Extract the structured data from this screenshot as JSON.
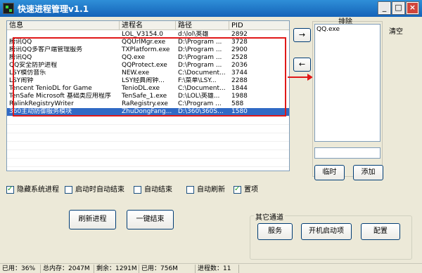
{
  "window": {
    "title": "快速进程管理v1.1",
    "icon": "terminal-icon",
    "controls": {
      "minimize": "_",
      "maximize": "□",
      "close": "×"
    }
  },
  "process_list": {
    "columns": [
      "信息",
      "进程名",
      "路径",
      "PID"
    ],
    "rows": [
      {
        "info": "",
        "name": "LOL_V3154.0",
        "path": "d:\\lol\\英雄",
        "pid": "2892"
      },
      {
        "info": "腾讯QQ",
        "name": "QQUrlMgr.exe",
        "path": "D:\\Program ...",
        "pid": "3728"
      },
      {
        "info": "腾讯QQ多客户端管理服务",
        "name": "TXPlatform.exe",
        "path": "D:\\Program ...",
        "pid": "2900"
      },
      {
        "info": "腾讯QQ",
        "name": "QQ.exe",
        "path": "D:\\Program ...",
        "pid": "2528"
      },
      {
        "info": "QQ安全防护进程",
        "name": "QQProtect.exe",
        "path": "D:\\Program ...",
        "pid": "2036"
      },
      {
        "info": "LSY模仿音乐",
        "name": "NEW.exe",
        "path": "C:\\Document...",
        "pid": "3744"
      },
      {
        "info": "LSY闹钟",
        "name": "LSY经典闹钟...",
        "path": "F:\\菜单\\LSY...",
        "pid": "2288"
      },
      {
        "info": "Tencent TenioDL for Game",
        "name": "TenioDL.exe",
        "path": "C:\\Document...",
        "pid": "1844"
      },
      {
        "info": "TenSafe Microsoft 基础类应用程序",
        "name": "TenSafe_1.exe",
        "path": "D:\\LOL\\英雄...",
        "pid": "1988"
      },
      {
        "info": "RalinkRegistryWriter",
        "name": "RaRegistry.exe",
        "path": "C:\\Program ...",
        "pid": "588"
      },
      {
        "info": "360主动防御服务模块",
        "name": "ZhuDongFang...",
        "path": "D:\\360\\360S...",
        "pid": "1580"
      }
    ],
    "selected_row": 10
  },
  "transfer": {
    "move_right": "→",
    "move_left": "←"
  },
  "exclude": {
    "label": "排除",
    "items": [
      "QQ.exe"
    ],
    "input_value": "",
    "clear_label": "清空",
    "temp_label": "临时",
    "add_label": "添加"
  },
  "options": [
    {
      "label": "隐藏系统进程",
      "checked": true
    },
    {
      "label": "启动时自动结束",
      "checked": false
    },
    {
      "label": "自动结束",
      "checked": false
    },
    {
      "label": "自动刷新",
      "checked": false
    },
    {
      "label": "置项",
      "checked": true
    }
  ],
  "actions": {
    "refresh": "刷新进程",
    "end_all": "一键结束"
  },
  "other_channels": {
    "title": "其它通道",
    "service": "服务",
    "startup": "开机启动项",
    "config": "配置"
  },
  "status": {
    "cpu_used": "已用：36%",
    "total_memory": "总内存：2047M",
    "remaining": "剩余：1291M",
    "memory_used": "已用：756M",
    "process_count": "进程数：11"
  },
  "colors": {
    "selection": "#316ac5",
    "highlight_box": "#e01818",
    "window_bg": "#ece9d8",
    "titlebar": "#1462b8"
  }
}
